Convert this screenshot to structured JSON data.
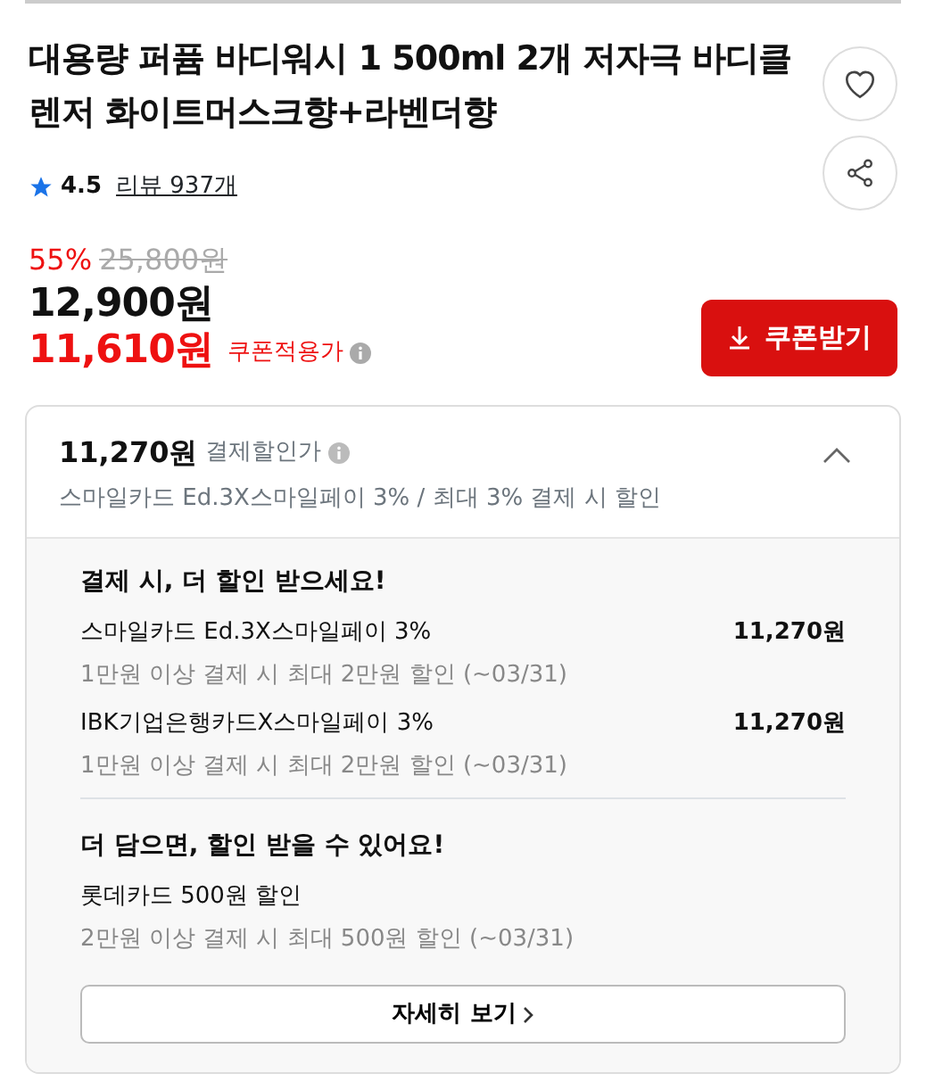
{
  "product": {
    "title": "대용량 퍼퓸 바디워시 1 500ml 2개 저자극 바디클렌저 화이트머스크향+라벤더향",
    "rating": "4.5",
    "reviews": "리뷰 937개"
  },
  "price": {
    "discount_rate": "55%",
    "original": "25,800원",
    "sale": "12,900원",
    "coupon_price": "11,610원",
    "coupon_label": "쿠폰적용가",
    "coupon_button": "쿠폰받기"
  },
  "payment_discount": {
    "expanded": true,
    "price": "11,270원",
    "label": "결제할인가",
    "summary": "스마일카드 Ed.3X스마일페이 3% / 최대 3% 결제 시 할인",
    "sections": [
      {
        "heading": "결제 시, 더 할인 받으세요!",
        "offers": [
          {
            "name": "스마일카드 Ed.3X스마일페이 3%",
            "price": "11,270원",
            "condition": "1만원 이상 결제 시 최대 2만원 할인 (~03/31)"
          },
          {
            "name": "IBK기업은행카드X스마일페이 3%",
            "price": "11,270원",
            "condition": "1만원 이상 결제 시 최대 2만원 할인 (~03/31)"
          }
        ]
      },
      {
        "heading": "더 담으면, 할인 받을 수 있어요!",
        "offers": [
          {
            "name": "롯데카드 500원 할인",
            "condition": "2만원 이상 결제 시 최대 500원 할인 (~03/31)"
          }
        ]
      }
    ],
    "more_button": "자세히 보기"
  }
}
